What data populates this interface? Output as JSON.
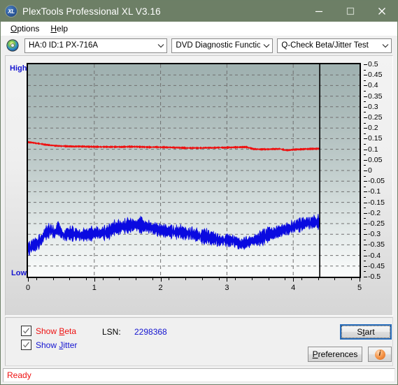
{
  "window": {
    "title": "PlexTools Professional XL V3.16",
    "app_icon": "xl-logo-icon",
    "minimize": "minimize-icon",
    "maximize": "maximize-icon",
    "close": "close-icon",
    "titlebar_color": "#6d7f66"
  },
  "menubar": {
    "items": [
      {
        "label": "Options",
        "accel": "O"
      },
      {
        "label": "Help",
        "accel": "H"
      }
    ]
  },
  "toolbar": {
    "disc_icon": "disc-icon",
    "drive_select": {
      "value": "HA:0 ID:1  PX-716A",
      "arrow": "chevron-down-icon"
    },
    "function_select": {
      "value": "DVD Diagnostic Functions",
      "arrow": "chevron-down-icon"
    },
    "test_select": {
      "value": "Q-Check Beta/Jitter Test",
      "arrow": "chevron-down-icon"
    }
  },
  "chart_labels": {
    "high": "High",
    "low": "Low"
  },
  "controls": {
    "show_beta": {
      "label_pre": "Show ",
      "label_accel": "B",
      "label_post": "eta",
      "checked": true,
      "color": "#ee1111"
    },
    "show_jitter": {
      "label_pre": "Show ",
      "label_accel": "J",
      "label_post": "itter",
      "checked": true,
      "color": "#1414d0"
    },
    "lsn_label": "LSN:",
    "lsn_value": "2298368",
    "start_button": {
      "pre": "S",
      "accel": "t",
      "post": "art",
      "label": "Start"
    },
    "preferences_button": {
      "accel": "P",
      "post": "references",
      "label": "Preferences"
    },
    "info_button": {
      "label": "i",
      "icon": "info-icon"
    }
  },
  "statusbar": {
    "text": "Ready"
  },
  "chart_data": {
    "type": "line",
    "title": "Q-Check Beta/Jitter Test",
    "xlabel": "",
    "ylabel": "",
    "xlim": [
      0,
      5
    ],
    "ylim": [
      -0.5,
      0.5
    ],
    "grid": true,
    "x_ticks": [
      "0",
      "1",
      "2",
      "3",
      "4",
      "5"
    ],
    "y_ticks": [
      "0.5",
      "0.45",
      "0.4",
      "0.35",
      "0.3",
      "0.25",
      "0.2",
      "0.15",
      "0.1",
      "0.05",
      "0",
      "-0.05",
      "-0.1",
      "-0.15",
      "-0.2",
      "-0.25",
      "-0.3",
      "-0.35",
      "-0.4",
      "-0.45",
      "-0.5"
    ],
    "y_major_gridlines": [
      0.45,
      0.4,
      0.35,
      0.3,
      0.25,
      0.2,
      0.15,
      0.1,
      0.05,
      0,
      -0.05,
      -0.1,
      -0.15,
      -0.2,
      -0.25,
      -0.3,
      -0.35,
      -0.4,
      -0.45
    ],
    "x_major_gridlines": [
      1,
      2,
      3,
      4
    ],
    "cursor_x": 4.4,
    "data_end_x": 4.4,
    "series": [
      {
        "name": "Beta",
        "color": "#ee1111",
        "x": [
          0.0,
          0.05,
          0.1,
          0.15,
          0.2,
          0.25,
          0.3,
          0.4,
          0.5,
          0.6,
          0.7,
          0.8,
          0.9,
          1.0,
          1.1,
          1.2,
          1.3,
          1.4,
          1.5,
          1.6,
          1.7,
          1.8,
          1.9,
          2.0,
          2.1,
          2.2,
          2.3,
          2.4,
          2.5,
          2.6,
          2.7,
          2.8,
          2.9,
          3.0,
          3.1,
          3.2,
          3.3,
          3.4,
          3.5,
          3.6,
          3.7,
          3.8,
          3.9,
          4.0,
          4.1,
          4.2,
          4.3,
          4.4
        ],
        "y": [
          0.133,
          0.132,
          0.129,
          0.127,
          0.125,
          0.122,
          0.12,
          0.117,
          0.115,
          0.114,
          0.113,
          0.113,
          0.112,
          0.112,
          0.111,
          0.111,
          0.111,
          0.111,
          0.112,
          0.112,
          0.111,
          0.11,
          0.11,
          0.11,
          0.109,
          0.108,
          0.107,
          0.106,
          0.106,
          0.106,
          0.107,
          0.107,
          0.108,
          0.108,
          0.109,
          0.11,
          0.11,
          0.101,
          0.1,
          0.1,
          0.101,
          0.102,
          0.095,
          0.098,
          0.1,
          0.101,
          0.102,
          0.103
        ],
        "noise": 0.004
      },
      {
        "name": "Jitter",
        "color": "#0a0ae0",
        "x": [
          0.0,
          0.05,
          0.1,
          0.15,
          0.2,
          0.25,
          0.3,
          0.35,
          0.4,
          0.45,
          0.5,
          0.55,
          0.6,
          0.7,
          0.8,
          0.9,
          1.0,
          1.1,
          1.2,
          1.3,
          1.4,
          1.5,
          1.6,
          1.7,
          1.8,
          1.9,
          2.0,
          2.1,
          2.2,
          2.3,
          2.4,
          2.5,
          2.6,
          2.7,
          2.8,
          2.9,
          3.0,
          3.1,
          3.2,
          3.3,
          3.4,
          3.5,
          3.6,
          3.7,
          3.8,
          3.9,
          4.0,
          4.1,
          4.2,
          4.3,
          4.4
        ],
        "y": [
          -0.37,
          -0.36,
          -0.35,
          -0.34,
          -0.33,
          -0.3,
          -0.285,
          -0.275,
          -0.3,
          -0.27,
          -0.29,
          -0.31,
          -0.295,
          -0.3,
          -0.305,
          -0.3,
          -0.295,
          -0.295,
          -0.29,
          -0.27,
          -0.265,
          -0.26,
          -0.255,
          -0.255,
          -0.265,
          -0.275,
          -0.28,
          -0.285,
          -0.29,
          -0.29,
          -0.295,
          -0.3,
          -0.31,
          -0.31,
          -0.32,
          -0.33,
          -0.325,
          -0.33,
          -0.345,
          -0.34,
          -0.33,
          -0.32,
          -0.305,
          -0.295,
          -0.285,
          -0.275,
          -0.265,
          -0.255,
          -0.25,
          -0.245,
          -0.24
        ],
        "noise": 0.03
      }
    ]
  }
}
